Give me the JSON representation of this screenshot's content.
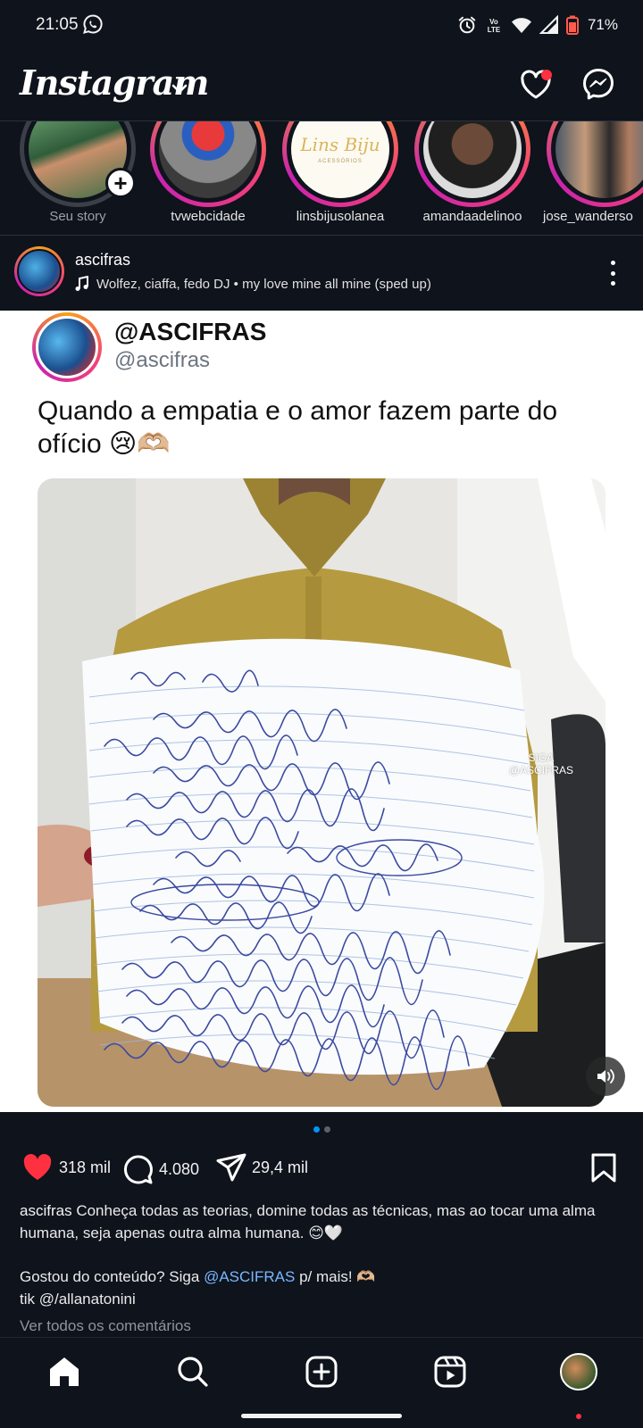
{
  "status_bar": {
    "time": "21:05",
    "battery": "71%",
    "icons": [
      "whatsapp-icon",
      "alarm-icon",
      "volte-icon",
      "wifi-icon",
      "signal-icon",
      "battery-icon"
    ]
  },
  "top_bar": {
    "logo": "Instagram",
    "icons": [
      "chevron-down-icon",
      "heart-icon",
      "messenger-icon"
    ],
    "notification_color": "#ff3040"
  },
  "stories": [
    {
      "label": "Seu story",
      "own": true
    },
    {
      "label": "tvwebcidade"
    },
    {
      "label": "linsbijusolanea",
      "logo_text": "Lins Biju",
      "logo_sub": "ACESSÓRIOS"
    },
    {
      "label": "amandaadelinoo"
    },
    {
      "label": "jose_wanderso"
    }
  ],
  "post": {
    "username": "ascifras",
    "music": "Wolfez, ciaffa, fedo DJ • my love mine all mine (sped up)",
    "media": {
      "display_name": "@ASCIFRAS",
      "handle": "@ascifras",
      "text": "Quando a empatia e o amor fazem parte do ofício 😢🫶🏼",
      "watermark_line1": "SIGA",
      "watermark_line2": "@ASCIFRAS",
      "photo_sign": "Olá Doutor"
    },
    "carousel": {
      "count": 2,
      "active": 1
    },
    "likes": "318 mil",
    "comments": "4.080",
    "shares": "29,4 mil",
    "caption": {
      "username": "ascifras",
      "text": "Conheça todas as teorias, domine todas as técnicas, mas ao tocar uma alma humana, seja apenas outra alma humana. 😊🤍",
      "line2_prefix": "Gostou do conteúdo? Siga",
      "line2_mention": "@ASCIFRAS",
      "line2_suffix": "p/ mais! 🫶🏼",
      "line3": "tik @/allanatonini"
    },
    "view_comments": "Ver todos os comentários"
  },
  "bottom_nav": {
    "items": [
      "home-icon",
      "search-icon",
      "create-icon",
      "reels-icon",
      "profile-avatar"
    ]
  },
  "colors": {
    "background": "#0e131c",
    "like": "#ff3040",
    "mention": "#7ab7ff",
    "active_dot": "#0095f6"
  }
}
